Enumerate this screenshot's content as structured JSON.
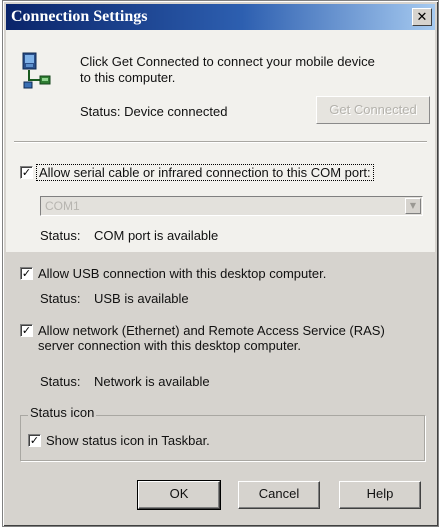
{
  "window": {
    "title": "Connection Settings",
    "close_glyph": "✕"
  },
  "header": {
    "icon": "device-connection-icon",
    "message": "Click Get Connected to connect your mobile device to this computer.",
    "status": "Status: Device connected",
    "get_connected_label": "Get Connected"
  },
  "com": {
    "checked": true,
    "label": "Allow serial cable or infrared connection to this COM port:",
    "port_value": "COM1",
    "status_label": "Status:",
    "status_value": "COM port is available"
  },
  "usb": {
    "checked": true,
    "label": "Allow USB connection with this desktop computer.",
    "status_label": "Status:",
    "status_value": "USB is available"
  },
  "network": {
    "checked": true,
    "label": "Allow network (Ethernet) and Remote Access Service (RAS) server connection with this desktop computer.",
    "status_label": "Status:",
    "status_value": "Network is available"
  },
  "status_icon_group": {
    "legend": "Status icon",
    "checked": true,
    "label": "Show status icon in Taskbar."
  },
  "buttons": {
    "ok": "OK",
    "cancel": "Cancel",
    "help": "Help"
  },
  "check_glyph": "✓"
}
